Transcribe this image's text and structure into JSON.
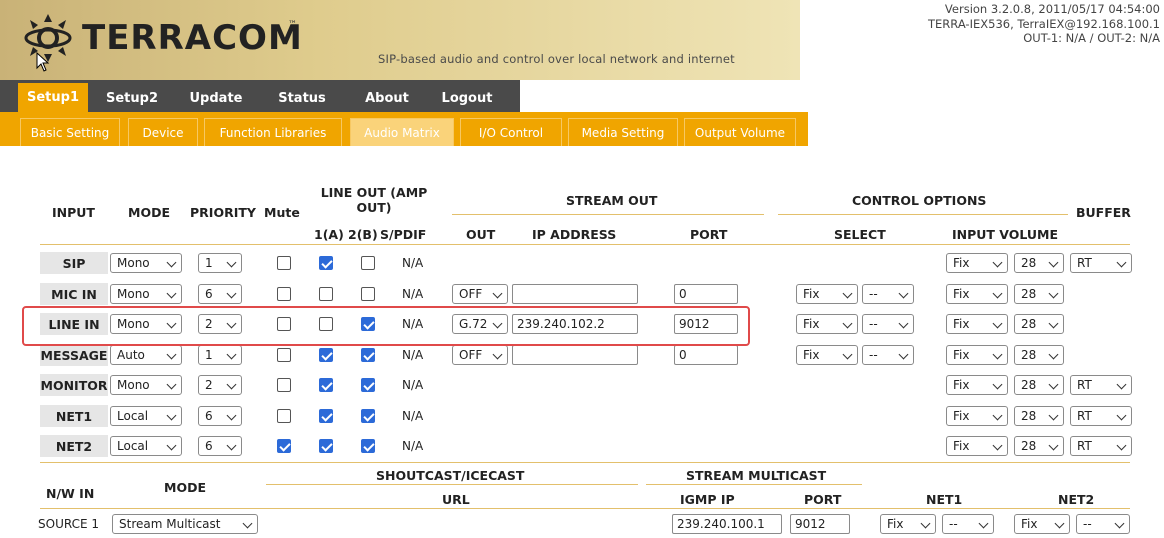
{
  "header": {
    "brand": "TERRACOM",
    "tm": "™",
    "tagline": "SIP-based audio and control over local network and internet",
    "version_line1": "Version 3.2.0.8, 2011/05/17 04:54:00",
    "version_line2": "TERRA-IEX536, TerraIEX@192.168.100.1",
    "version_line3": "OUT-1: N/A / OUT-2: N/A"
  },
  "main_nav": [
    "Setup1",
    "Setup2",
    "Update",
    "Status",
    "About",
    "Logout"
  ],
  "sub_nav": [
    "Basic Setting",
    "Device",
    "Function Libraries",
    "Audio Matrix",
    "I/O Control",
    "Media Setting",
    "Output Volume"
  ],
  "headers": {
    "input": "INPUT",
    "mode": "MODE",
    "priority": "PRIORITY",
    "mute": "Mute",
    "lineout": "LINE OUT (AMP OUT)",
    "lineout_1": "1(A)",
    "lineout_2": "2(B)",
    "spdif": "S/PDIF",
    "stream_out": "STREAM OUT",
    "out": "OUT",
    "ip": "IP ADDRESS",
    "port": "PORT",
    "control_options": "CONTROL OPTIONS",
    "select": "SELECT",
    "input_volume": "INPUT VOLUME",
    "buffer": "BUFFER"
  },
  "rows": [
    {
      "input": "SIP",
      "mode": "Mono",
      "priority": "1",
      "mute": false,
      "l1": true,
      "l2": false,
      "spdif": "N/A",
      "out": "",
      "ip": "",
      "port": "",
      "sel1": "",
      "sel2": "",
      "vol1": "Fix",
      "vol2": "28",
      "buffer": "RT"
    },
    {
      "input": "MIC IN",
      "mode": "Mono",
      "priority": "6",
      "mute": false,
      "l1": false,
      "l2": false,
      "spdif": "N/A",
      "out": "OFF",
      "ip": "",
      "port": "0",
      "sel1": "Fix",
      "sel2": "--",
      "vol1": "Fix",
      "vol2": "28",
      "buffer": ""
    },
    {
      "input": "LINE IN",
      "mode": "Mono",
      "priority": "2",
      "mute": false,
      "l1": false,
      "l2": true,
      "spdif": "N/A",
      "out": "G.72",
      "ip": "239.240.102.2",
      "port": "9012",
      "sel1": "Fix",
      "sel2": "--",
      "vol1": "Fix",
      "vol2": "28",
      "buffer": ""
    },
    {
      "input": "MESSAGE",
      "mode": "Auto",
      "priority": "1",
      "mute": false,
      "l1": true,
      "l2": true,
      "spdif": "N/A",
      "out": "OFF",
      "ip": "",
      "port": "0",
      "sel1": "Fix",
      "sel2": "--",
      "vol1": "Fix",
      "vol2": "28",
      "buffer": ""
    },
    {
      "input": "MONITOR",
      "mode": "Mono",
      "priority": "2",
      "mute": false,
      "l1": true,
      "l2": true,
      "spdif": "N/A",
      "out": "",
      "ip": "",
      "port": "",
      "sel1": "",
      "sel2": "",
      "vol1": "Fix",
      "vol2": "28",
      "buffer": "RT"
    },
    {
      "input": "NET1",
      "mode": "Local",
      "priority": "6",
      "mute": false,
      "l1": true,
      "l2": true,
      "spdif": "N/A",
      "out": "",
      "ip": "",
      "port": "",
      "sel1": "",
      "sel2": "",
      "vol1": "Fix",
      "vol2": "28",
      "buffer": "RT"
    },
    {
      "input": "NET2",
      "mode": "Local",
      "priority": "6",
      "mute": true,
      "l1": true,
      "l2": true,
      "spdif": "N/A",
      "out": "",
      "ip": "",
      "port": "",
      "sel1": "",
      "sel2": "",
      "vol1": "Fix",
      "vol2": "28",
      "buffer": "RT"
    }
  ],
  "nw": {
    "nw_in": "N/W IN",
    "mode": "MODE",
    "shoutcast": "SHOUTCAST/ICECAST",
    "url": "URL",
    "stream_multicast": "STREAM MULTICAST",
    "igmp_ip": "IGMP IP",
    "port": "PORT",
    "net1": "NET1",
    "net2": "NET2",
    "source_label": "SOURCE 1",
    "source_mode": "Stream Multicast",
    "igmp_value": "239.240.100.1",
    "port_value": "9012",
    "net1_a": "Fix",
    "net1_b": "--",
    "net2_a": "Fix",
    "net2_b": "--"
  },
  "colors": {
    "accent": "#f0a500",
    "nav_dark": "#4a4a4a",
    "highlight": "#e04a4a",
    "check": "#2c6ad8"
  }
}
